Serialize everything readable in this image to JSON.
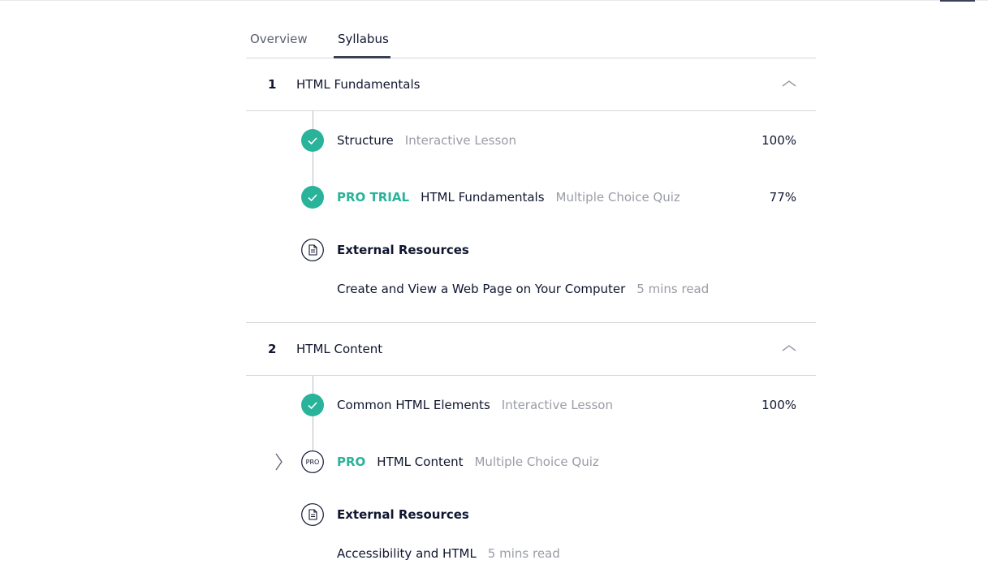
{
  "tabs": [
    {
      "label": "Overview",
      "active": false
    },
    {
      "label": "Syllabus",
      "active": true
    }
  ],
  "modules": [
    {
      "number": "1",
      "title": "HTML Fundamentals",
      "items": [
        {
          "badge": "",
          "title": "Structure",
          "type": "Interactive Lesson",
          "progress": "100%",
          "status": "complete"
        },
        {
          "badge": "PRO TRIAL",
          "title": "HTML Fundamentals",
          "type": "Multiple Choice Quiz",
          "progress": "77%",
          "status": "complete"
        }
      ],
      "resources": {
        "heading": "External Resources",
        "link": "Create and View a Web Page on Your Computer",
        "read_time": "5 mins read"
      }
    },
    {
      "number": "2",
      "title": "HTML Content",
      "items": [
        {
          "badge": "",
          "title": "Common HTML Elements",
          "type": "Interactive Lesson",
          "progress": "100%",
          "status": "complete"
        },
        {
          "badge": "PRO",
          "title": "HTML Content",
          "type": "Multiple Choice Quiz",
          "progress": "",
          "status": "pro-locked",
          "icon_label": "PRO"
        }
      ],
      "resources": {
        "heading": "External Resources",
        "link": "Accessibility and HTML",
        "read_time": "5 mins read"
      }
    }
  ],
  "colors": {
    "accent": "#29b39a",
    "text": "#10162f",
    "muted": "#9a9ca6",
    "divider": "#d6d7dc"
  },
  "icons": {
    "complete": "check-circle-icon",
    "pro": "pro-circle-icon",
    "resource": "document-icon",
    "collapse": "chevron-up-icon",
    "expand": "chevron-right-icon"
  }
}
